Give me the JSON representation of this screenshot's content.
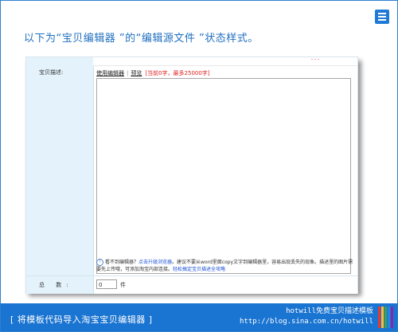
{
  "page": {
    "heading": "以下为“宝贝编辑器 ”的“编辑源文件 ”状态样式。"
  },
  "form": {
    "field_label": "宝贝描述:",
    "toolbar": {
      "mode_use_editor": "使用编辑器",
      "mode_preview": "预览",
      "char_hint": "[当前0字，最多25000字]"
    },
    "top_strip_mark": "- - -",
    "editor_content": "",
    "notes": {
      "line1_prefix": "看不到编辑器？",
      "line1_link": "点击升级浏览器",
      "line1_rest": "。建议不要从word里面copy文字到编辑器里，容易出现丢失的现象。描述里的图片需要先上传哦，可添加淘宝内部连接。",
      "line2_link": "轻松搞定宝贝描述全攻略"
    },
    "total_label": "总 数:",
    "quantity_value": "0",
    "quantity_unit": "件"
  },
  "footer": {
    "title": "[ 将模板代码导入淘宝宝贝编辑器 ]",
    "brand_line1": "hotwill免费宝贝描述模板",
    "brand_line2": "http://blog.sina.com.cn/hotwill"
  },
  "colors": {
    "accent": "#1a74d1",
    "heading": "#1f6fbf",
    "label_bg": "#e4f3fb",
    "hint_red": "#e02020",
    "link_blue": "#1a4fd6"
  },
  "icons": {
    "corner": "menu-icon",
    "notes": "info-icon",
    "footer": "color-stripes-icon"
  }
}
